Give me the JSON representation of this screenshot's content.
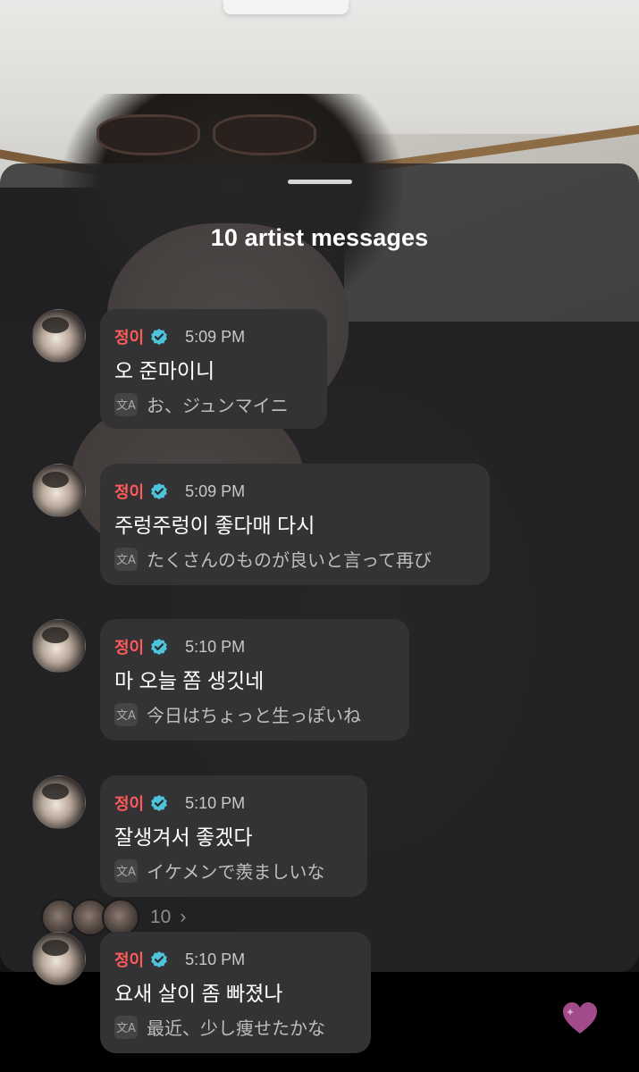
{
  "sheet": {
    "title": "10 artist messages"
  },
  "messages": [
    {
      "sender": "정이",
      "time": "5:09 PM",
      "text": "오 준마이니",
      "translation": "お、ジュンマイニ"
    },
    {
      "sender": "정이",
      "time": "5:09 PM",
      "text": "주렁주렁이 좋다매 다시",
      "translation": "たくさんのものが良いと言って再び"
    },
    {
      "sender": "정이",
      "time": "5:10 PM",
      "text": "마 오늘 쫌 생깃네",
      "translation": "今日はちょっと生っぽいね"
    },
    {
      "sender": "정이",
      "time": "5:10 PM",
      "text": "잘생겨서 좋겠다",
      "translation": "イケメンで羨ましいな"
    },
    {
      "sender": "정이",
      "time": "5:10 PM",
      "text": "요새 살이 좀 빠졌나",
      "translation": "最近、少し痩せたかな"
    }
  ],
  "viewers": {
    "count": "10"
  },
  "icons": {
    "verified": "verified-badge-icon",
    "translate": "translate-icon",
    "heart": "heart-icon",
    "chevron": "chevron-right-icon"
  },
  "colors": {
    "sender_name": "#ff5a5a",
    "verified_badge": "#4fc3dc",
    "heart": "#a24a8a"
  }
}
